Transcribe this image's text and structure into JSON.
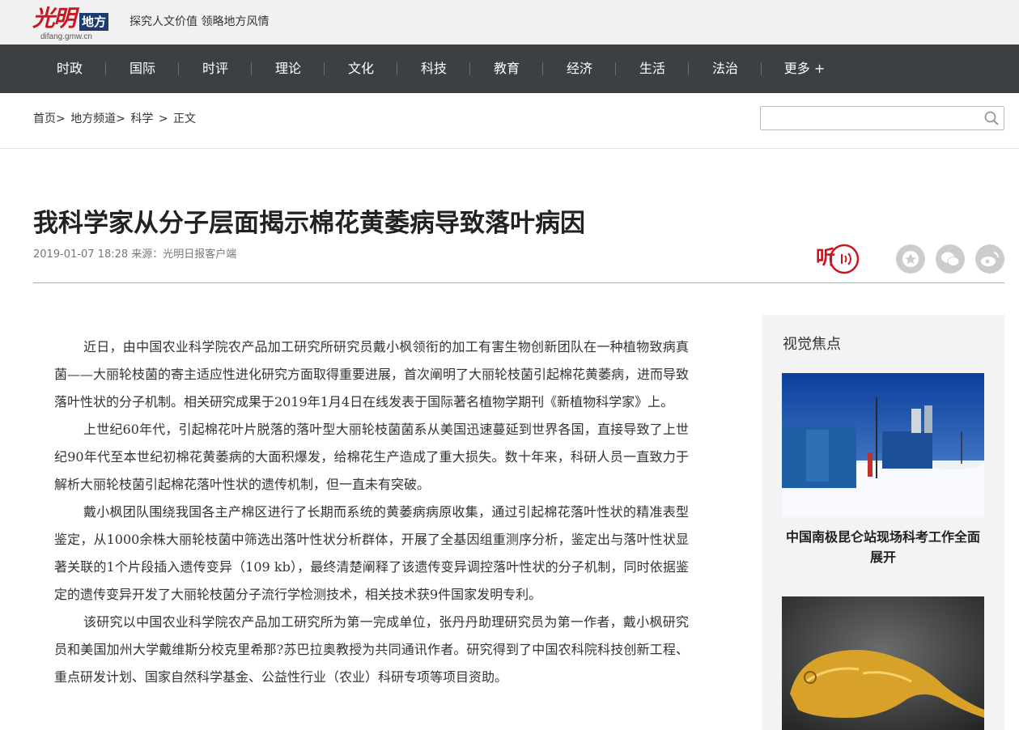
{
  "header": {
    "logo_text": "光明",
    "logo_box": "地方",
    "logo_url": "difang.gmw.cn",
    "slogan": "探究人文价值  领略地方风情"
  },
  "nav": {
    "items": [
      "时政",
      "国际",
      "时评",
      "理论",
      "文化",
      "科技",
      "教育",
      "经济",
      "生活",
      "法治",
      "更多 +"
    ]
  },
  "breadcrumb": {
    "home": "首页>",
    "channel": "地方频道>",
    "section": "科学",
    "sep": ">",
    "current": "正文"
  },
  "search": {
    "placeholder": "",
    "icon": "search-icon"
  },
  "article": {
    "title": "我科学家从分子层面揭示棉花黄萎病导致落叶病因",
    "meta": "2019-01-07 18:28  来源：光明日报客户端",
    "listen_label": "听",
    "paragraphs": [
      "近日，由中国农业科学院农产品加工研究所研究员戴小枫领衔的加工有害生物创新团队在一种植物致病真菌——大丽轮枝菌的寄主适应性进化研究方面取得重要进展，首次阐明了大丽轮枝菌引起棉花黄萎病，进而导致落叶性状的分子机制。相关研究成果于2019年1月4日在线发表于国际著名植物学期刊《新植物科学家》上。",
      "上世纪60年代，引起棉花叶片脱落的落叶型大丽轮枝菌菌系从美国迅速蔓延到世界各国，直接导致了上世纪90年代至本世纪初棉花黄萎病的大面积爆发，给棉花生产造成了重大损失。数十年来，科研人员一直致力于解析大丽轮枝菌引起棉花落叶性状的遗传机制，但一直未有突破。",
      "戴小枫团队围绕我国各主产棉区进行了长期而系统的黄萎病病原收集，通过引起棉花落叶性状的精准表型鉴定，从1000余株大丽轮枝菌中筛选出落叶性状分析群体，开展了全基因组重测序分析，鉴定出与落叶性状显著关联的1个片段插入遗传变异（109 kb），最终清楚阐释了该遗传变异调控落叶性状的分子机制，同时依据鉴定的遗传变异开发了大丽轮枝菌分子流行学检测技术，相关技术获9件国家发明专利。",
      "该研究以中国农业科学院农产品加工研究所为第一完成单位，张丹丹助理研究员为第一作者，戴小枫研究员和美国加州大学戴维斯分校克里希那?苏巴拉奥教授为共同通讯作者。研究得到了中国农科院科技创新工程、重点研发计划、国家自然科学基金、公益性行业（农业）科研专项等项目资助。"
    ]
  },
  "sidebar": {
    "title": "视觉焦点",
    "items": [
      {
        "caption": "中国南极昆仑站现场科考工作全面展开"
      }
    ]
  }
}
